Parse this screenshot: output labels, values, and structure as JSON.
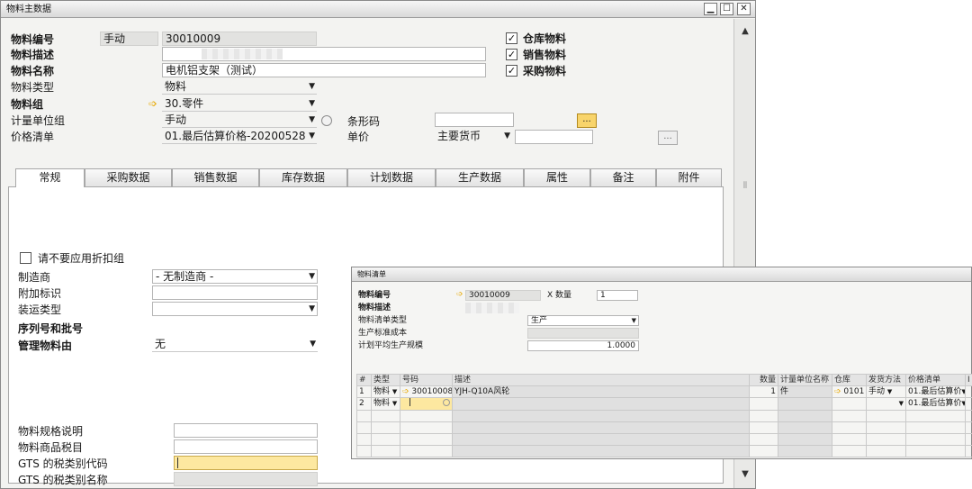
{
  "main_window": {
    "title": "物料主数据",
    "controls": {
      "minimize": "▁",
      "maximize": "☐",
      "close": "✕"
    },
    "labels": {
      "item_no": "物料编号",
      "item_desc": "物料描述",
      "item_name": "物料名称",
      "item_type": "物料类型",
      "item_group": "物料组",
      "uom_group": "计量单位组",
      "price_list": "价格清单",
      "barcode": "条形码",
      "unit_price": "单价"
    },
    "values": {
      "numbering": "手动",
      "item_no": "30010009",
      "item_desc": "",
      "item_name": "电机铝支架（测试）",
      "item_type": "物料",
      "item_group": "30.零件",
      "uom_group": "手动",
      "price_list": "01.最后估算价格-20200528",
      "barcode": "",
      "currency": "主要货币",
      "unit_price": ""
    },
    "checkboxes": [
      {
        "label": "仓库物料",
        "checked": "✓"
      },
      {
        "label": "销售物料",
        "checked": "✓"
      },
      {
        "label": "采购物料",
        "checked": "✓"
      }
    ],
    "ellipsis": "...",
    "tabs": [
      "常规",
      "采购数据",
      "销售数据",
      "库存数据",
      "计划数据",
      "生产数据",
      "属性",
      "备注",
      "附件"
    ],
    "general": {
      "no_discount_label": "请不要应用折扣组",
      "manufacturer_label": "制造商",
      "manufacturer_value": "- 无制造商 -",
      "additional_id_label": "附加标识",
      "shipping_type_label": "装运类型",
      "serial_batch_title": "序列号和批号",
      "manage_by_label": "管理物料由",
      "manage_by_value": "无",
      "spec_label": "物料规格说明",
      "tax_category_label": "物料商品税目",
      "gts_code_label": "GTS 的税类别代码",
      "gts_name_label": "GTS 的税类别名称"
    },
    "scroll": {
      "up": "▲",
      "down": "▼",
      "grip": "⦀"
    }
  },
  "bom_window": {
    "title": "物料清单",
    "labels": {
      "item_no": "物料编号",
      "item_desc": "物料描述",
      "bom_type": "物料清单类型",
      "std_cost": "生产标准成本",
      "planned_qty": "计划平均生产规模",
      "x_qty": "X 数量"
    },
    "values": {
      "item_no": "30010009",
      "quantity": "1",
      "item_desc": "",
      "bom_type": "生产",
      "std_cost": "",
      "planned_qty": "1.0000"
    },
    "columns": [
      "#",
      "类型",
      "号码",
      "描述",
      "数量",
      "计量单位名称",
      "仓库",
      "发货方法",
      "价格清单",
      "I"
    ],
    "rows": [
      {
        "no": "1",
        "type": "物料",
        "number": "30010008",
        "desc": "YJH-Q10A风轮",
        "qty": "1",
        "uom": "件",
        "warehouse": "0101",
        "issue": "手动",
        "price_list": "01.最后估算价"
      },
      {
        "no": "2",
        "type": "物料",
        "number": "",
        "desc": "",
        "qty": "",
        "uom": "",
        "warehouse": "",
        "issue": "",
        "price_list": "01.最后估算价"
      }
    ]
  }
}
